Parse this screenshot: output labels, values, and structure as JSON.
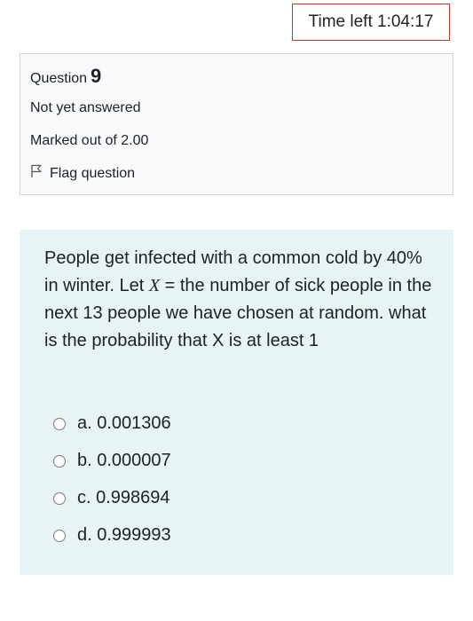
{
  "timer": {
    "label": "Time left 1:04:17"
  },
  "info": {
    "question_label": "Question",
    "question_number": "9",
    "state": "Not yet answered",
    "grade": "Marked out of 2.00",
    "flag_label": "Flag question"
  },
  "question": {
    "text_part1": "People get infected with a common cold by 40% in winter. Let ",
    "var_x": "X",
    "text_part2": " = the number of sick people in the next 13 people we have chosen at random. what is the probability that X is at least 1"
  },
  "answers": [
    {
      "label": "a. 0.001306"
    },
    {
      "label": "b. 0.000007"
    },
    {
      "label": "c. 0.998694"
    },
    {
      "label": "d. 0.999993"
    }
  ],
  "colors": {
    "timer_border": "#c0392b",
    "info_background": "#f8f9fa",
    "content_background": "#e7f3f5"
  }
}
